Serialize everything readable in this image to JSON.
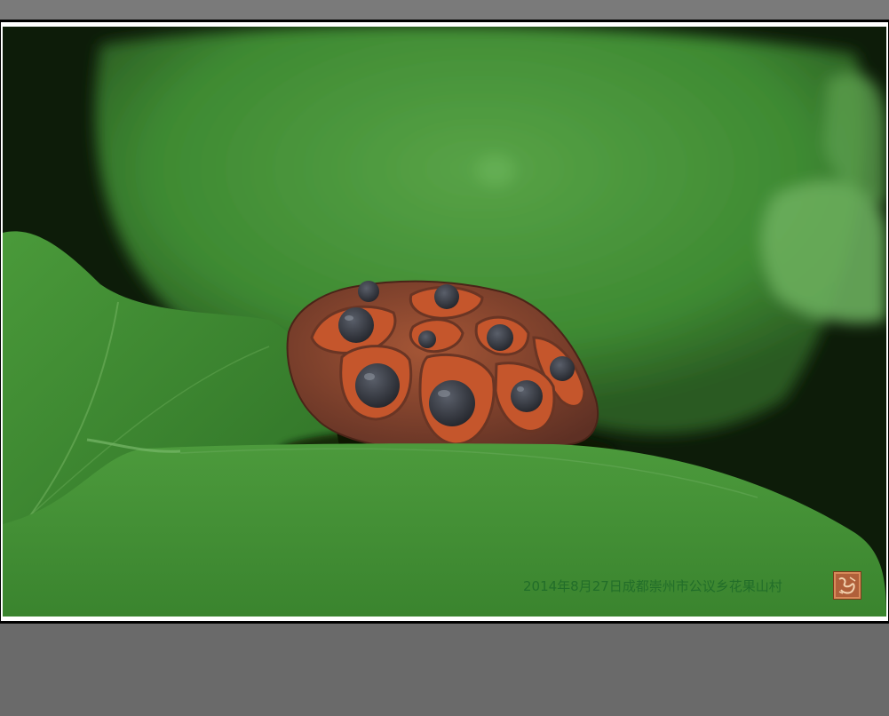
{
  "photo": {
    "subject": "lotus-seed-pod-on-leaf",
    "caption": "2014年8月27日成都崇州市公议乡花果山村",
    "seal_icon": "red-seal-stamp"
  },
  "colors": {
    "leaf_bright": "#4f9a3a",
    "leaf_dark": "#2d6a22",
    "pod_rust": "#8a3e22",
    "seed_dark": "#2e3138",
    "background_dark": "#0c1a08",
    "caption_green": "#1f6b29"
  }
}
